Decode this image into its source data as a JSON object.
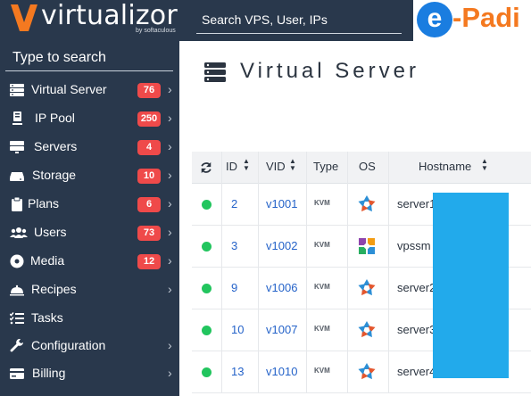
{
  "header": {
    "logo_text": "virtualizor",
    "logo_sub": "by softaculous",
    "search_text": "Search VPS, User, IPs",
    "brand_e": "e",
    "brand_text": "-Padi",
    "colors": {
      "bar": "#29384c",
      "brand_orange": "#f47920",
      "brand_blue": "#1a7de0"
    }
  },
  "sidebar": {
    "search_text": "Type to search",
    "items": [
      {
        "label": "Virtual Server",
        "icon": "server-stack-icon",
        "badge": "76",
        "chevron": "›"
      },
      {
        "label": "IP Pool",
        "icon": "ip-pool-icon",
        "badge": "250",
        "chevron": "›"
      },
      {
        "label": "Servers",
        "icon": "monitor-icon",
        "badge": "4",
        "chevron": "›"
      },
      {
        "label": "Storage",
        "icon": "storage-drive-icon",
        "badge": "10",
        "chevron": "›"
      },
      {
        "label": "Plans",
        "icon": "clipboard-icon",
        "badge": "6",
        "chevron": "›"
      },
      {
        "label": "Users",
        "icon": "users-icon",
        "badge": "73",
        "chevron": "›"
      },
      {
        "label": "Media",
        "icon": "disc-icon",
        "badge": "12",
        "chevron": "›"
      },
      {
        "label": "Recipes",
        "icon": "cloche-icon",
        "badge": "",
        "chevron": "›"
      },
      {
        "label": "Tasks",
        "icon": "tasks-list-icon",
        "badge": "",
        "chevron": ""
      },
      {
        "label": "Configuration",
        "icon": "wrench-icon",
        "badge": "",
        "chevron": "›"
      },
      {
        "label": "Billing",
        "icon": "billing-icon",
        "badge": "",
        "chevron": "›"
      }
    ],
    "badge_color": "#ef4a4a"
  },
  "main": {
    "title": "Virtual Server",
    "columns": [
      "ID",
      "VID",
      "Type",
      "OS",
      "Hostname"
    ],
    "refresh_icon": "refresh-icon",
    "rows": [
      {
        "status": "running",
        "id": "2",
        "vid": "v1001",
        "type": "KVM",
        "os": "os-logo-icon",
        "hostname": "server1"
      },
      {
        "status": "running",
        "id": "3",
        "vid": "v1002",
        "type": "KVM",
        "os": "os-logo-icon",
        "hostname": "vpssm"
      },
      {
        "status": "running",
        "id": "9",
        "vid": "v1006",
        "type": "KVM",
        "os": "os-logo-icon",
        "hostname": "server2"
      },
      {
        "status": "running",
        "id": "10",
        "vid": "v1007",
        "type": "KVM",
        "os": "os-logo-icon",
        "hostname": "server3"
      },
      {
        "status": "running",
        "id": "13",
        "vid": "v1010",
        "type": "KVM",
        "os": "os-logo-icon",
        "hostname": "server4"
      }
    ],
    "status_color": "#22c55e",
    "link_color": "#2563c9",
    "redaction_color": "#22aaeb"
  }
}
